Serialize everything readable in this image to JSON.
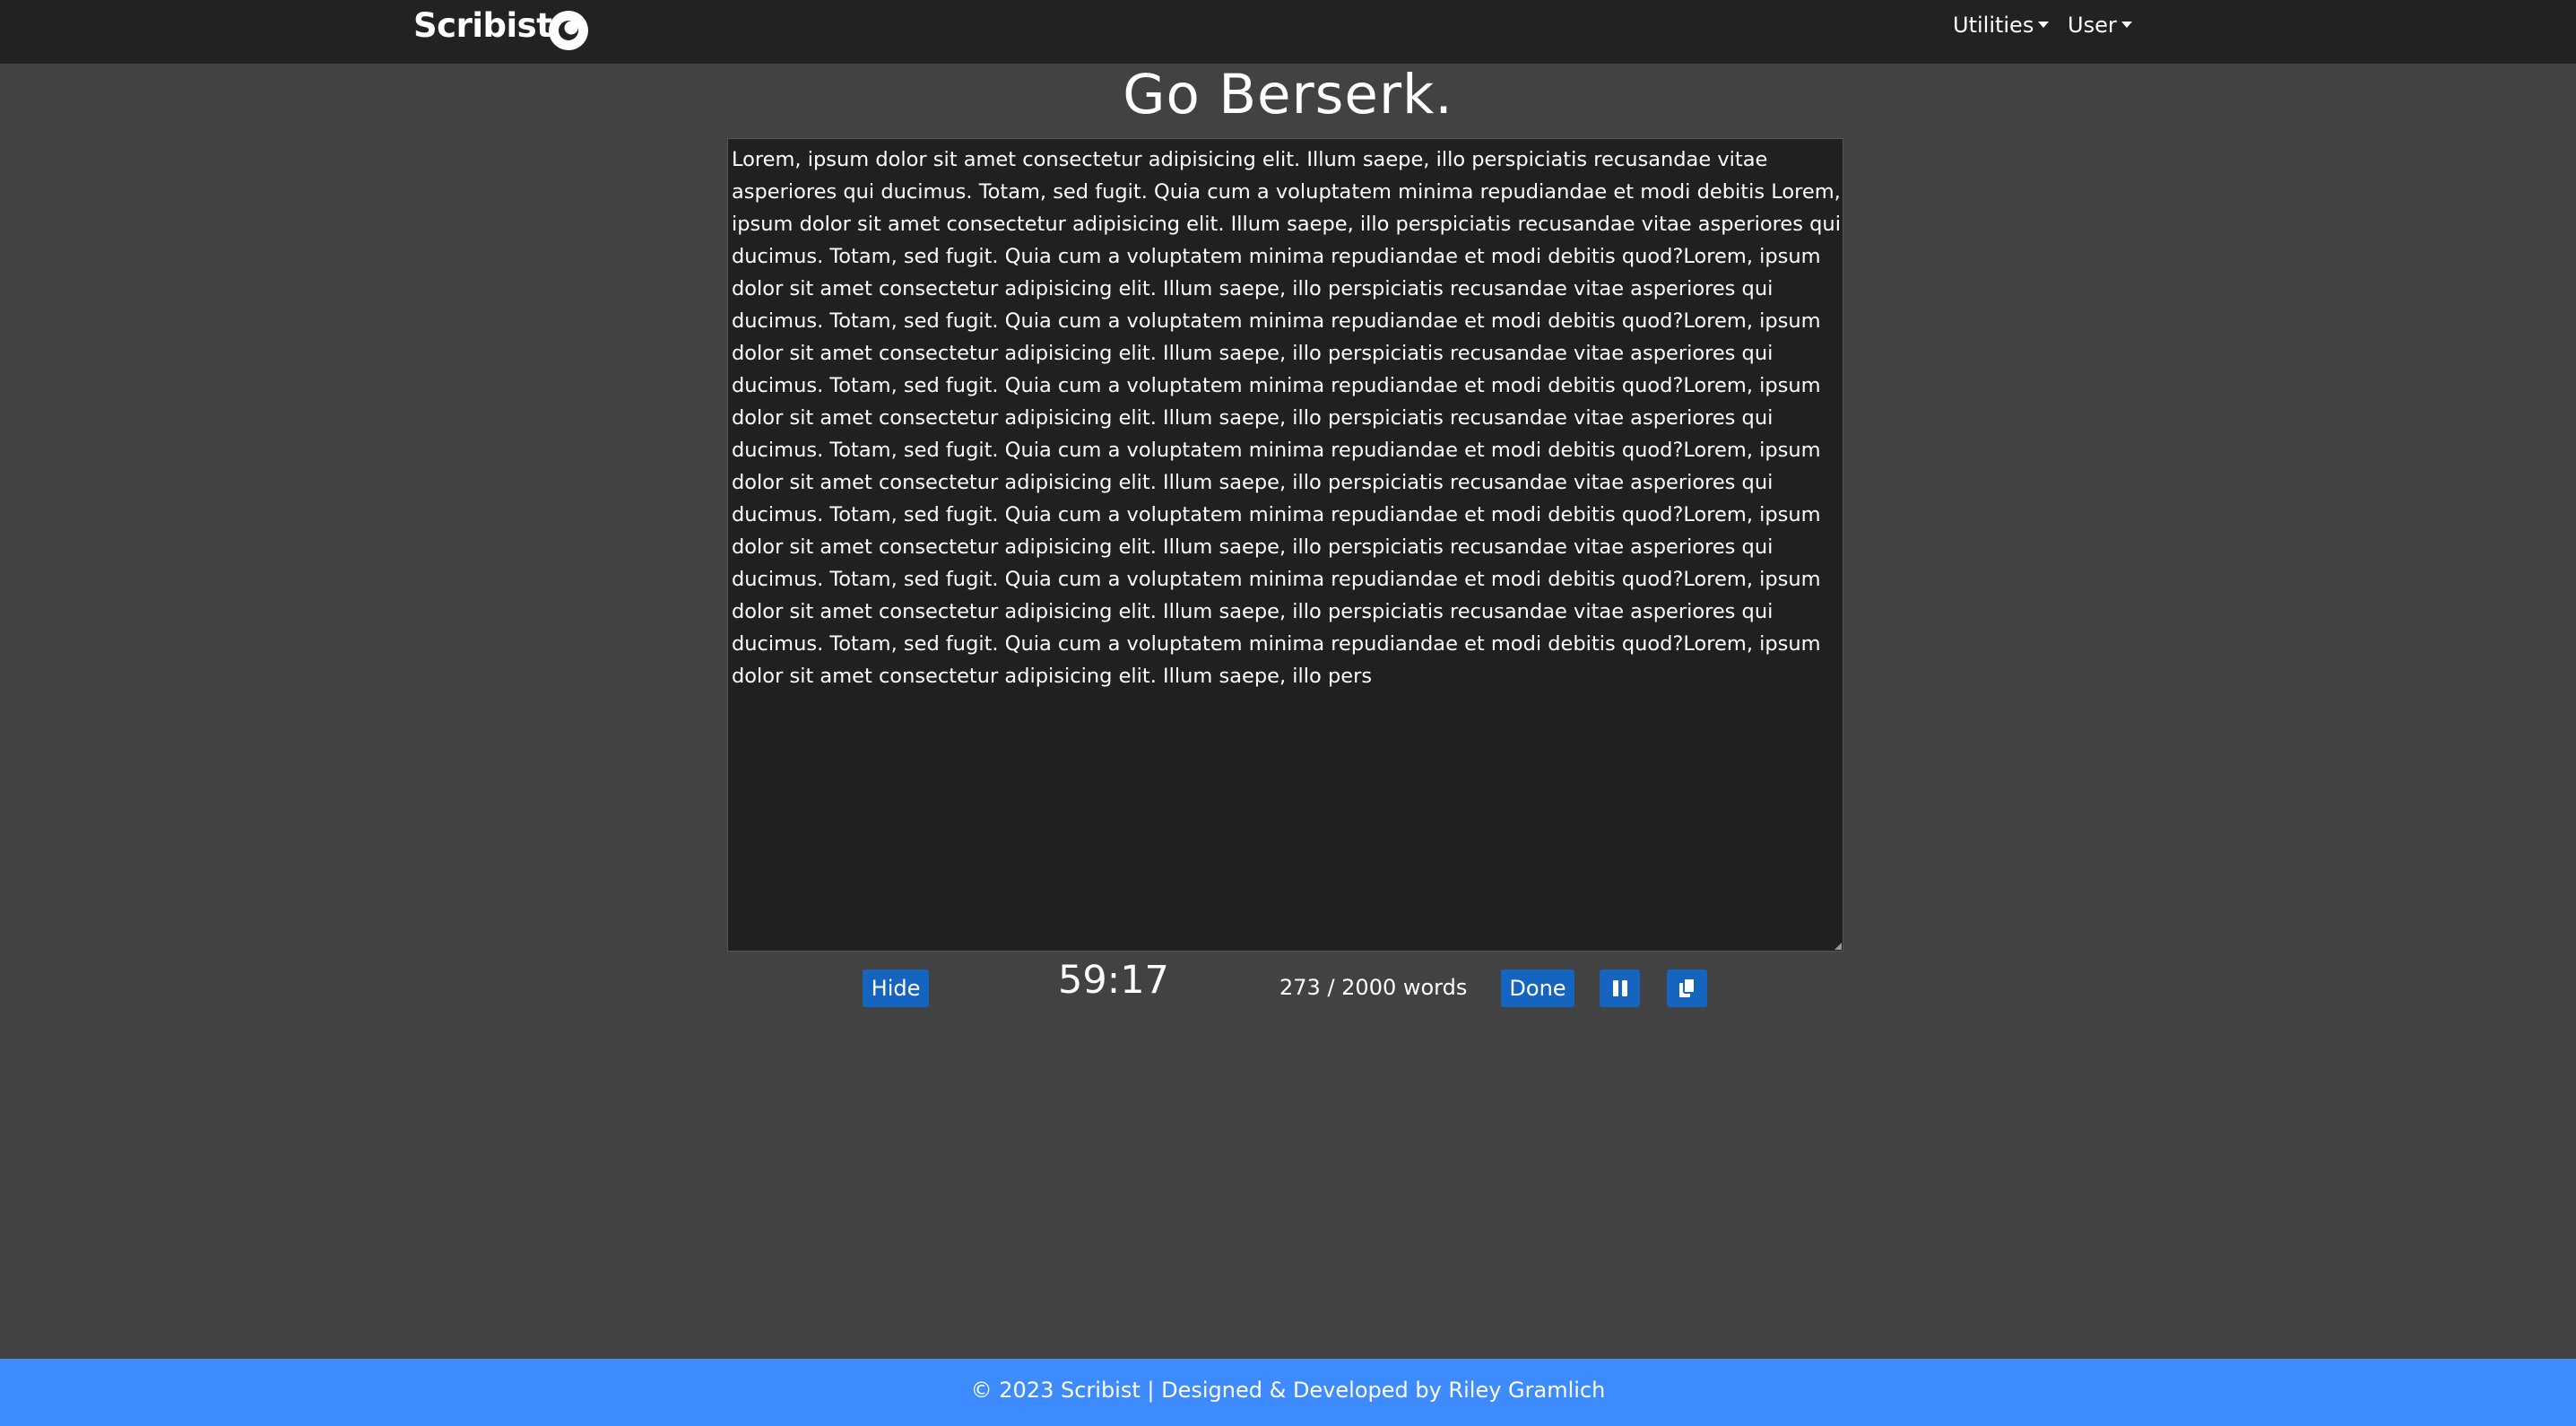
{
  "navbar": {
    "brand": "Scribist",
    "theme_toggle_icon": "moon-icon",
    "menus": [
      {
        "label": "Utilities"
      },
      {
        "label": "User"
      }
    ]
  },
  "page_title": "Go Berserk.",
  "editor": {
    "text": "Lorem, ipsum dolor sit amet consectetur adipisicing elit. Illum saepe, illo perspiciatis recusandae vitae asperiores qui ducimus. Totam, sed fugit. Quia cum a voluptatem minima repudiandae et modi debitis Lorem, ipsum dolor sit amet consectetur adipisicing elit. Illum saepe, illo perspiciatis recusandae vitae asperiores qui ducimus. Totam, sed fugit. Quia cum a voluptatem minima repudiandae et modi debitis quod?Lorem, ipsum dolor sit amet consectetur adipisicing elit. Illum saepe, illo perspiciatis recusandae vitae asperiores qui ducimus. Totam, sed fugit. Quia cum a voluptatem minima repudiandae et modi debitis quod?Lorem, ipsum dolor sit amet consectetur adipisicing elit. Illum saepe, illo perspiciatis recusandae vitae asperiores qui ducimus. Totam, sed fugit. Quia cum a voluptatem minima repudiandae et modi debitis quod?Lorem, ipsum dolor sit amet consectetur adipisicing elit. Illum saepe, illo perspiciatis recusandae vitae asperiores qui ducimus. Totam, sed fugit. Quia cum a voluptatem minima repudiandae et modi debitis quod?Lorem, ipsum dolor sit amet consectetur adipisicing elit. Illum saepe, illo perspiciatis recusandae vitae asperiores qui ducimus. Totam, sed fugit. Quia cum a voluptatem minima repudiandae et modi debitis quod?Lorem, ipsum dolor sit amet consectetur adipisicing elit. Illum saepe, illo perspiciatis recusandae vitae asperiores qui ducimus. Totam, sed fugit. Quia cum a voluptatem minima repudiandae et modi debitis quod?Lorem, ipsum dolor sit amet consectetur adipisicing elit. Illum saepe, illo perspiciatis recusandae vitae asperiores qui ducimus. Totam, sed fugit. Quia cum a voluptatem minima repudiandae et modi debitis quod?Lorem, ipsum dolor sit amet consectetur adipisicing elit. Illum saepe, illo pers"
  },
  "controls": {
    "hide_label": "Hide",
    "timer": "59:17",
    "word_count": "273 / 2000 words",
    "done_label": "Done",
    "pause_icon": "pause-icon",
    "copy_icon": "copy-icon"
  },
  "footer": {
    "text": "© 2023 Scribist | Designed & Developed by Riley Gramlich"
  },
  "colors": {
    "page_bg": "#424242",
    "navbar_bg": "#222220",
    "editor_bg": "#20201e",
    "button_bg": "#1565c0",
    "footer_bg": "#3d8bfd"
  }
}
